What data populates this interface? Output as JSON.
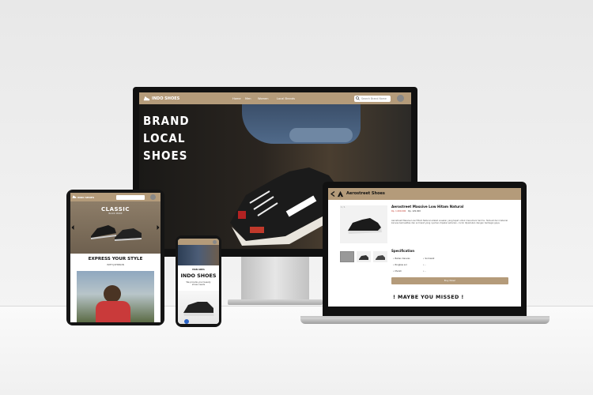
{
  "desktop": {
    "brand": "INDO SHOES",
    "nav": [
      "Home",
      "Men",
      "Women",
      "Local Brands"
    ],
    "search_placeholder": "Search Brand Name",
    "hero_words": [
      "BRAND",
      "LOCAL",
      "SHOES"
    ]
  },
  "laptop": {
    "page_title": "Aerostreet Shoes",
    "product_name": "Aerostreet Massive Low Hitam Natural",
    "sold": "Rp. 1.000.000",
    "price": "Rp. 129.900",
    "description": "Aerostreet Massive Low Hitam Natural adalah sneaker yang tepat untuk menemani harimu. Terbuat dari material kanvas berkualitas dan sol karet yang nyaman dipakai seharian, cocok dipadukan dengan berbagai gaya.",
    "spec_title": "Specification",
    "specs": [
      "Bahan Kanvas",
      "Ringkas sol",
      "Murah"
    ],
    "specs_right": [
      "Sol karet",
      "-",
      "-"
    ],
    "buy_label": "Buy Now!",
    "missed": "! MAYBE YOU MISSED !"
  },
  "tablet": {
    "brand": "INDO SHOES",
    "classic_title": "CLASSIC",
    "classic_sub": "BLACK MODE",
    "express": "EXPRESS YOUR STYLE",
    "express_sub": "WITH JOHNSON"
  },
  "phone": {
    "small_top": "MAN AREA",
    "title": "INDO SHOES",
    "tagline": "We provide your beauty shoes needs"
  },
  "colors": {
    "accent": "#b49b7a",
    "dark": "#111111"
  }
}
